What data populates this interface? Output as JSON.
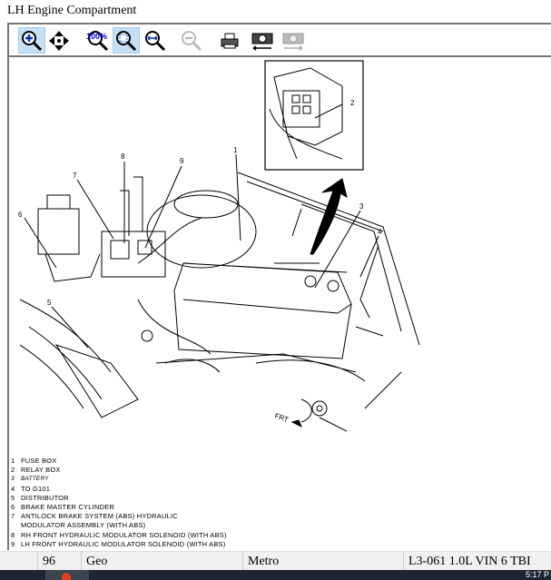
{
  "window": {
    "title": "LH Engine Compartment"
  },
  "toolbar": [
    {
      "name": "zoom-in-icon",
      "active": true
    },
    {
      "name": "pan-icon",
      "active": false
    },
    {
      "name": "zoom-100-icon",
      "active": false
    },
    {
      "name": "zoom-fit-icon",
      "active": true
    },
    {
      "name": "zoom-width-icon",
      "active": false
    },
    {
      "name": "zoom-out-icon",
      "active": false,
      "disabled": true
    },
    {
      "name": "print-icon",
      "active": false
    },
    {
      "name": "camera-back-icon",
      "active": false
    },
    {
      "name": "camera-forward-icon",
      "active": false,
      "disabled": true
    }
  ],
  "diagram": {
    "callouts": [
      "1",
      "2",
      "3",
      "4",
      "5",
      "6",
      "7",
      "8",
      "9"
    ],
    "front_label": "FRT"
  },
  "legend": [
    {
      "num": "1",
      "text": "FUSE BOX"
    },
    {
      "num": "2",
      "text": "RELAY BOX"
    },
    {
      "num": "3",
      "text": "BATTERY"
    },
    {
      "num": "4",
      "text": "TO G101"
    },
    {
      "num": "5",
      "text": "DISTRIBUTOR"
    },
    {
      "num": "6",
      "text": "BRAKE MASTER CYLINDER"
    },
    {
      "num": "7",
      "text": "ANTILOCK BRAKE SYSTEM (ABS) HYDRAULIC",
      "text2": "MODULATOR ASSEMBLY (WITH ABS)"
    },
    {
      "num": "8",
      "text": "RH FRONT HYDRAULIC MODULATOR SOLENOID (WITH ABS)"
    },
    {
      "num": "9",
      "text": "LH FRONT HYDRAULIC MODULATOR SOLENOID (WITH ABS)"
    }
  ],
  "status": {
    "year": "96",
    "make": "Geo",
    "model": "Metro",
    "engine": "L3-061 1.0L VIN 6 TBI"
  },
  "taskbar": {
    "clock": "5:17 P"
  }
}
